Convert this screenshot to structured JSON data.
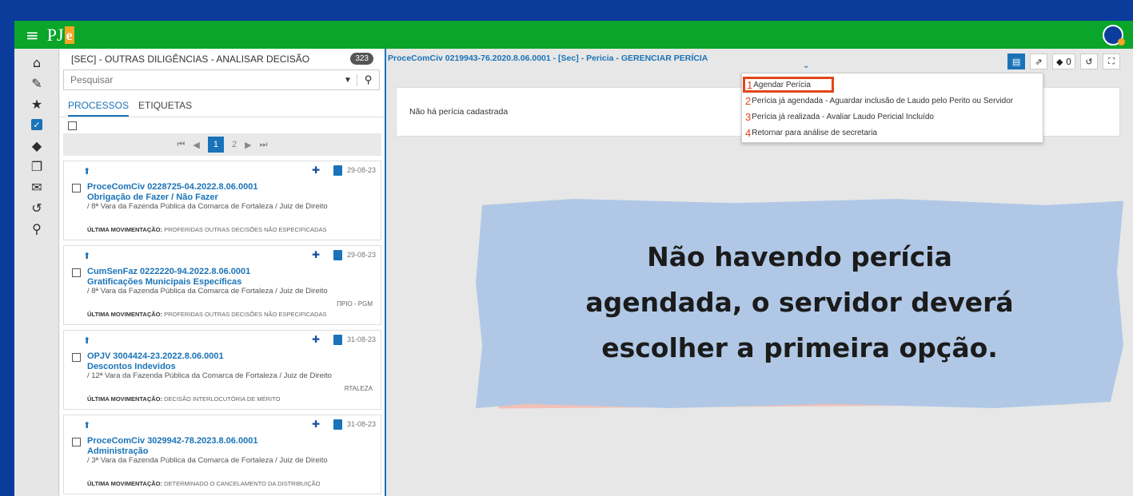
{
  "topbar": {
    "logo_text": "PJ",
    "logo_e": "e",
    "menu_icon": "hamburger-icon",
    "avatar_icon": "user-avatar-icon"
  },
  "colors": {
    "accent": "#1a73b8",
    "topbar": "#0aa52a",
    "frame": "#0b3c9c",
    "highlight": "#e2461b",
    "note_blue": "#b0c8e6",
    "note_pink": "#f1c1b7"
  },
  "leftnav": {
    "icons": [
      "home-icon",
      "pencil-icon",
      "star-icon",
      "checkbox-icon",
      "tags-icon",
      "copy-icon",
      "envelope-icon",
      "history-icon",
      "search-icon"
    ]
  },
  "list": {
    "header": "[SEC] - OUTRAS DILIGÊNCIAS - ANALISAR DECISÃO",
    "count": "323",
    "search_placeholder": "Pesquisar",
    "tabs": [
      "PROCESSOS",
      "ETIQUETAS"
    ],
    "pager": {
      "first": "⏮",
      "prev": "◀",
      "pages": [
        "1",
        "2"
      ],
      "next": "▶",
      "last": "⏭"
    },
    "items": [
      {
        "date": "29-08-23",
        "number": "ProceComCiv 0228725-04.2022.8.06.0001",
        "class": "Obrigação de Fazer / Não Fazer",
        "org": "/ 8ª Vara da Fazenda Pública da Comarca de Fortaleza / Juiz de Direito",
        "extra": "",
        "mov_label": "ÚLTIMA MOVIMENTAÇÃO:",
        "mov": "PROFERIDAS OUTRAS DECISÕES NÃO ESPECIFICADAS"
      },
      {
        "date": "29-08-23",
        "number": "CumSenFaz 0222220-94.2022.8.06.0001",
        "class": "Gratificações Municipais Específicas",
        "org": "/ 8ª Vara da Fazenda Pública da Comarca de Fortaleza / Juiz de Direito",
        "extra": "ΠPIO - PGM",
        "mov_label": "ÚLTIMA MOVIMENTAÇÃO:",
        "mov": "PROFERIDAS OUTRAS DECISÕES NÃO ESPECIFICADAS"
      },
      {
        "date": "31-08-23",
        "number": "OPJV 3004424-23.2022.8.06.0001",
        "class": "Descontos Indevidos",
        "org": "/ 12ª Vara da Fazenda Pública da Comarca de Fortaleza / Juiz de Direito",
        "extra": "RTALEZA",
        "mov_label": "ÚLTIMA MOVIMENTAÇÃO:",
        "mov": "DECISÃO INTERLOCUTÓRIA DE MÉRITO"
      },
      {
        "date": "31-08-23",
        "number": "ProceComCiv 3029942-78.2023.8.06.0001",
        "class": "Administração",
        "org": "/ 3ª Vara da Fazenda Pública da Comarca de Fortaleza / Juiz de Direito",
        "extra": "",
        "mov_label": "ÚLTIMA MOVIMENTAÇÃO:",
        "mov": "DETERMINADO O CANCELAMENTO DA DISTRIBUIÇÃO"
      }
    ]
  },
  "main": {
    "title": "ProceComCiv 0219943-76.2020.8.06.0001 - [Sec] - Pericia - GERENCIAR PERÍCIA",
    "toolbar": {
      "tags_count": "0"
    },
    "notice": "Não há perícia cadastrada",
    "options": [
      {
        "n": "1",
        "label": "Agendar Perícia"
      },
      {
        "n": "2",
        "label": "Perícia já agendada - Aguardar inclusão de Laudo pelo Perito ou Servidor"
      },
      {
        "n": "3",
        "label": "Perícia já realizada - Avaliar Laudo Pericial Incluído"
      },
      {
        "n": "4",
        "label": "Retornar para análise de secretaria"
      }
    ]
  },
  "note": {
    "line1": "Não havendo perícia",
    "line2": "agendada, o servidor deverá",
    "line3": "escolher a primeira opção."
  }
}
